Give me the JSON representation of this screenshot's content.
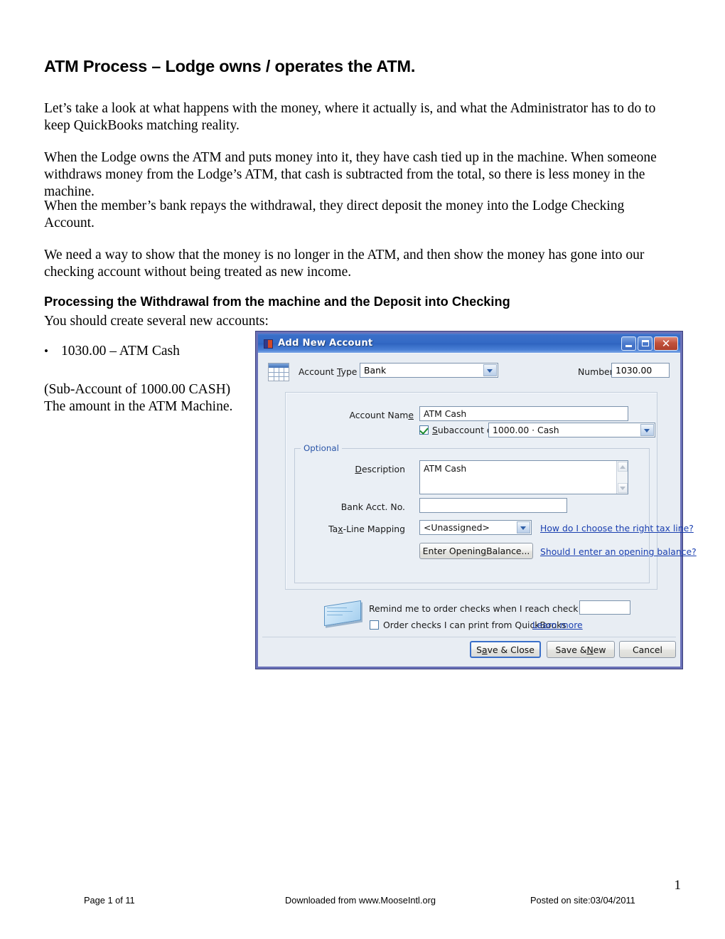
{
  "document": {
    "title": "ATM Process – Lodge owns / operates the ATM.",
    "paragraph_1": "Let’s take a look at what happens with the money, where it actually is, and what the Administrator has to do to keep QuickBooks matching reality.",
    "paragraph_2": "When the Lodge owns the ATM and puts money into it, they have cash tied up in the machine.  When someone withdraws money from the Lodge’s ATM, that cash is subtracted from the total, so there is less money in the machine.",
    "paragraph_3": "When the member’s bank repays the withdrawal, they direct deposit the money into the Lodge Checking Account.",
    "paragraph_4": "We need a way to show that the money is no longer in the ATM, and then show the money has gone into our checking account without being treated as new income.",
    "section_heading": "Processing the Withdrawal from the machine and the Deposit into Checking",
    "subheading": "You should create several new accounts:",
    "bullet_dot": "•",
    "bullet_1": "1030.00 – ATM Cash",
    "note_line_1": "(Sub-Account of 1000.00 CASH)",
    "note_line_2": "The amount in the ATM Machine.",
    "page_number": "1"
  },
  "footer": {
    "left": "Page 1 of 11",
    "middle": "Downloaded from www.MooseIntl.org",
    "right": "Posted on site:03/04/2011"
  },
  "dialog": {
    "title": "Add New Account",
    "window_controls": {
      "minimize": "–",
      "maximize": "□",
      "close": "✕"
    },
    "account_type": {
      "label_before": "Account ",
      "label_accel": "T",
      "label_after": "ype",
      "value": "Bank"
    },
    "number": {
      "label": "Number",
      "value": "1030.00"
    },
    "account_name": {
      "label_before": "Account Nam",
      "label_accel": "e",
      "label_after": "",
      "value": "ATM Cash"
    },
    "subaccount": {
      "label_accel": "S",
      "label_after": "ubaccount of",
      "checked": true,
      "value": "1000.00 · Cash"
    },
    "optional_legend": "Optional",
    "description": {
      "label_accel": "D",
      "label_after": "escription",
      "value": "ATM Cash"
    },
    "bank_acct_no": {
      "label": "Bank Acct. No.",
      "value": ""
    },
    "tax_line_mapping": {
      "label_before": "Ta",
      "label_accel": "x",
      "label_after": "-Line Mapping",
      "value": "<Unassigned>"
    },
    "links": {
      "tax_line": "How do I choose the right tax line?",
      "opening_balance": "Should I enter an opening balance?",
      "learn_more": "Learn more"
    },
    "buttons": {
      "opening_balance_before": "Enter Openin",
      "opening_balance_accel": "g",
      "opening_balance_after": " Balance...",
      "save_close_before": "S",
      "save_close_accel": "a",
      "save_close_after": "ve & Close",
      "save_new_before": "Save & ",
      "save_new_accel": "N",
      "save_new_after": "ew",
      "cancel": "Cancel"
    },
    "check_reminder": {
      "text": "Remind me to order checks when I reach check number",
      "value": "",
      "order_checks_label": "Order checks I can print from QuickBooks",
      "order_checks_checked": false
    }
  },
  "colors": {
    "titlebar_blue": "#2f64c0",
    "dialog_border": "#6a71b8",
    "dialog_face": "#e8edf3",
    "link_blue": "#1a3fb0",
    "legend_blue": "#2b56a8",
    "close_red": "#c2523c",
    "check_green": "#1a8a2e"
  }
}
